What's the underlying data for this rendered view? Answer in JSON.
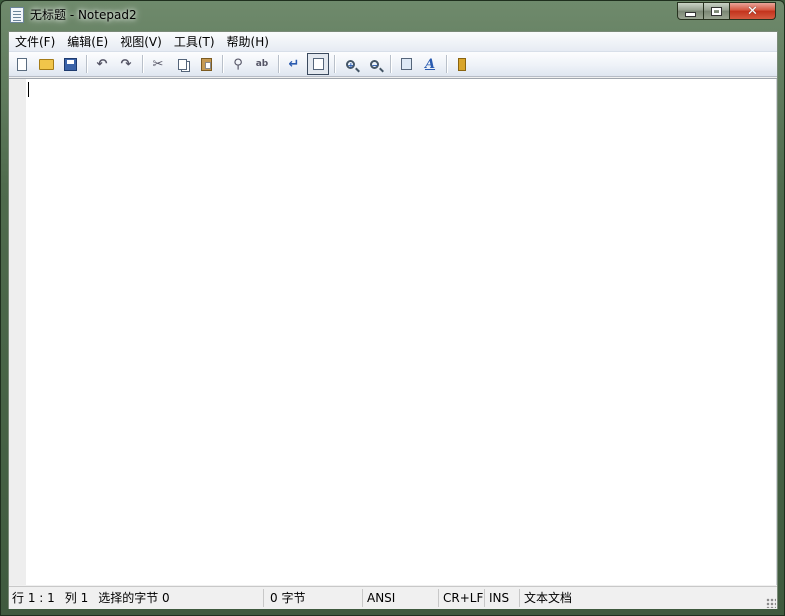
{
  "window": {
    "title": "无标题 - Notepad2"
  },
  "titlebar": {
    "minimize_glyph": "",
    "maximize_glyph": "",
    "close_glyph": "✕"
  },
  "menu": {
    "items": [
      {
        "label": "文件(F)",
        "name": "menu-file"
      },
      {
        "label": "编辑(E)",
        "name": "menu-edit"
      },
      {
        "label": "视图(V)",
        "name": "menu-view"
      },
      {
        "label": "工具(T)",
        "name": "menu-tools"
      },
      {
        "label": "帮助(H)",
        "name": "menu-help"
      }
    ]
  },
  "toolbar": {
    "icons": [
      "new-file-icon",
      "open-folder-icon",
      "save-icon",
      "undo-icon",
      "redo-icon",
      "cut-icon",
      "copy-icon",
      "paste-icon",
      "find-icon",
      "replace-icon",
      "word-wrap-icon",
      "view-toggle-icon",
      "zoom-in-icon",
      "zoom-out-icon",
      "settings-icon",
      "font-icon",
      "exit-icon"
    ],
    "undo_glyph": "↶",
    "redo_glyph": "↷",
    "cut_glyph": "✂",
    "find_glyph": "⚲",
    "replace_glyph": "ab",
    "wrap_glyph": "↵",
    "font_glyph": "A",
    "zoom_in_glyph": "+",
    "zoom_out_glyph": "−"
  },
  "editor": {
    "content": ""
  },
  "status": {
    "line_label": "行 1 : 1",
    "col_label": "列 1",
    "selected_label": "选择的字节 0",
    "bytes_label": "0 字节",
    "encoding": "ANSI",
    "line_ending": "CR+LF",
    "insert_mode": "INS",
    "doc_type": "文本文档"
  },
  "colors": {
    "frame": "#4f6b4d",
    "menu_bg": "#eef2f8",
    "editor_bg": "#ffffff",
    "gutter_bg": "#eeeeee",
    "close_button": "#c2321c"
  }
}
